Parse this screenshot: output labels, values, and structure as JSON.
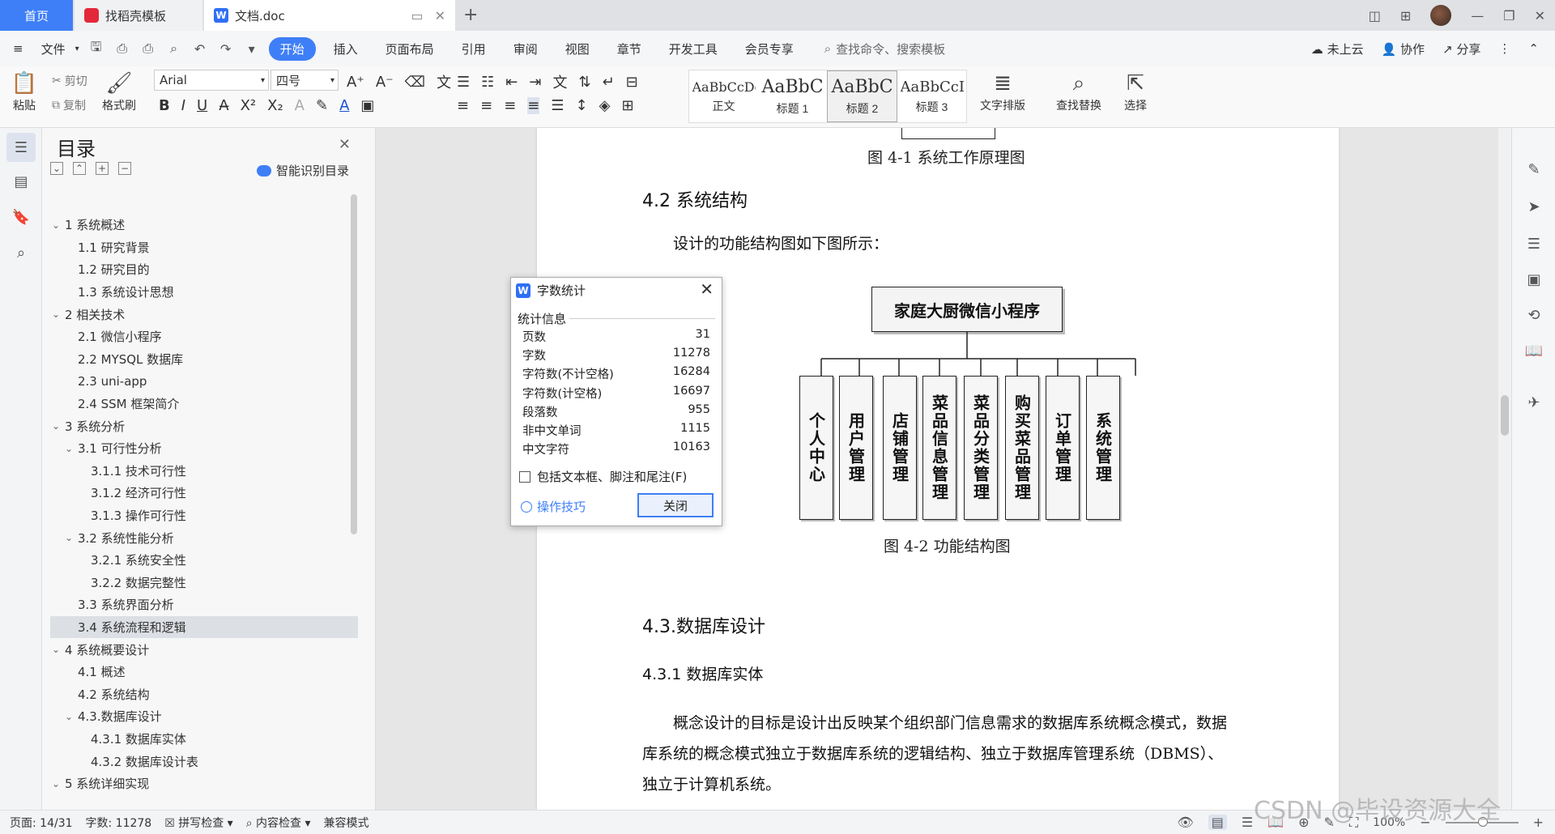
{
  "tabs": {
    "home": "首页",
    "daoke": "找稻壳模板",
    "doc": "文档.doc"
  },
  "menu": {
    "file": "文件",
    "items": [
      "开始",
      "插入",
      "页面布局",
      "引用",
      "审阅",
      "视图",
      "章节",
      "开发工具",
      "会员专享"
    ],
    "search": "查找命令、搜索模板",
    "cloud": "未上云",
    "collab": "协作",
    "share": "分享"
  },
  "ribbon": {
    "paste": "粘贴",
    "cut": "剪切",
    "copy": "复制",
    "format_painter": "格式刷",
    "font_name": "Arial",
    "font_size": "四号",
    "styles": [
      {
        "sample": "AaBbCcDd",
        "name": "正文"
      },
      {
        "sample": "AaBbC",
        "name": "标题 1"
      },
      {
        "sample": "AaBbC",
        "name": "标题 2"
      },
      {
        "sample": "AaBbCcI",
        "name": "标题 3"
      }
    ],
    "text_layout": "文字排版",
    "find_replace": "查找替换",
    "select": "选择"
  },
  "toc": {
    "title": "目录",
    "smart": "智能识别目录",
    "items": [
      {
        "level": 1,
        "text": "1 系统概述",
        "expand": true
      },
      {
        "level": 2,
        "text": "1.1  研究背景"
      },
      {
        "level": 2,
        "text": "1.2 研究目的"
      },
      {
        "level": 2,
        "text": "1.3 系统设计思想"
      },
      {
        "level": 1,
        "text": "2 相关技术",
        "expand": true
      },
      {
        "level": 2,
        "text": "2.1 微信小程序"
      },
      {
        "level": 2,
        "text": "2.2 MYSQL 数据库"
      },
      {
        "level": 2,
        "text": "2.3 uni-app"
      },
      {
        "level": 2,
        "text": "2.4 SSM 框架简介"
      },
      {
        "level": 1,
        "text": "3 系统分析",
        "expand": true
      },
      {
        "level": 2,
        "text": "3.1 可行性分析",
        "expand": true
      },
      {
        "level": 3,
        "text": "3.1.1 技术可行性"
      },
      {
        "level": 3,
        "text": "3.1.2 经济可行性"
      },
      {
        "level": 3,
        "text": "3.1.3 操作可行性"
      },
      {
        "level": 2,
        "text": "3.2 系统性能分析",
        "expand": true
      },
      {
        "level": 3,
        "text": "3.2.1  系统安全性"
      },
      {
        "level": 3,
        "text": "3.2.2  数据完整性"
      },
      {
        "level": 2,
        "text": "3.3 系统界面分析"
      },
      {
        "level": 2,
        "text": "3.4 系统流程和逻辑",
        "selected": true
      },
      {
        "level": 1,
        "text": "4 系统概要设计",
        "expand": true
      },
      {
        "level": 2,
        "text": "4.1 概述"
      },
      {
        "level": 2,
        "text": "4.2 系统结构"
      },
      {
        "level": 2,
        "text": "4.3.数据库设计",
        "expand": true
      },
      {
        "level": 3,
        "text": "4.3.1 数据库实体"
      },
      {
        "level": 3,
        "text": "4.3.2 数据库设计表"
      },
      {
        "level": 1,
        "text": "5 系统详细实现",
        "expand": true
      }
    ]
  },
  "doc": {
    "fig41_caption": "图 4-1 系统工作原理图",
    "h_42": "4.2 系统结构",
    "p_struct": "设计的功能结构图如下图所示：",
    "chart_root": "家庭大厨微信小程序",
    "chart_nodes": [
      "个人中心",
      "用户管理",
      "店铺管理",
      "菜品信息管理",
      "菜品分类管理",
      "购买菜品管理",
      "订单管理",
      "系统管理"
    ],
    "fig42_caption": "图 4-2 功能结构图",
    "h_43": "4.3.数据库设计",
    "h_431": "4.3.1 数据库实体",
    "p_line1": "概念设计的目标是设计出反映某个组织部门信息需求的数据库系统概念模式，数据",
    "p_line2": "库系统的概念模式独立于数据库系统的逻辑结构、独立于数据库管理系统（DBMS）、",
    "p_line3": "独立于计算机系统。"
  },
  "dialog": {
    "title": "字数统计",
    "section": "统计信息",
    "rows": [
      {
        "label": "页数",
        "value": "31"
      },
      {
        "label": "字数",
        "value": "11278"
      },
      {
        "label": "字符数(不计空格)",
        "value": "16284"
      },
      {
        "label": "字符数(计空格)",
        "value": "16697"
      },
      {
        "label": "段落数",
        "value": "955"
      },
      {
        "label": "非中文单词",
        "value": "1115"
      },
      {
        "label": "中文字符",
        "value": "10163"
      }
    ],
    "checkbox": "包括文本框、脚注和尾注(F)",
    "tips": "操作技巧",
    "close": "关闭"
  },
  "status": {
    "page": "页面: 14/31",
    "words": "字数: 11278",
    "spell": "拼写检查",
    "content_check": "内容检查",
    "compat": "兼容模式",
    "zoom": "100%"
  },
  "watermark": "CSDN @毕设资源大全"
}
